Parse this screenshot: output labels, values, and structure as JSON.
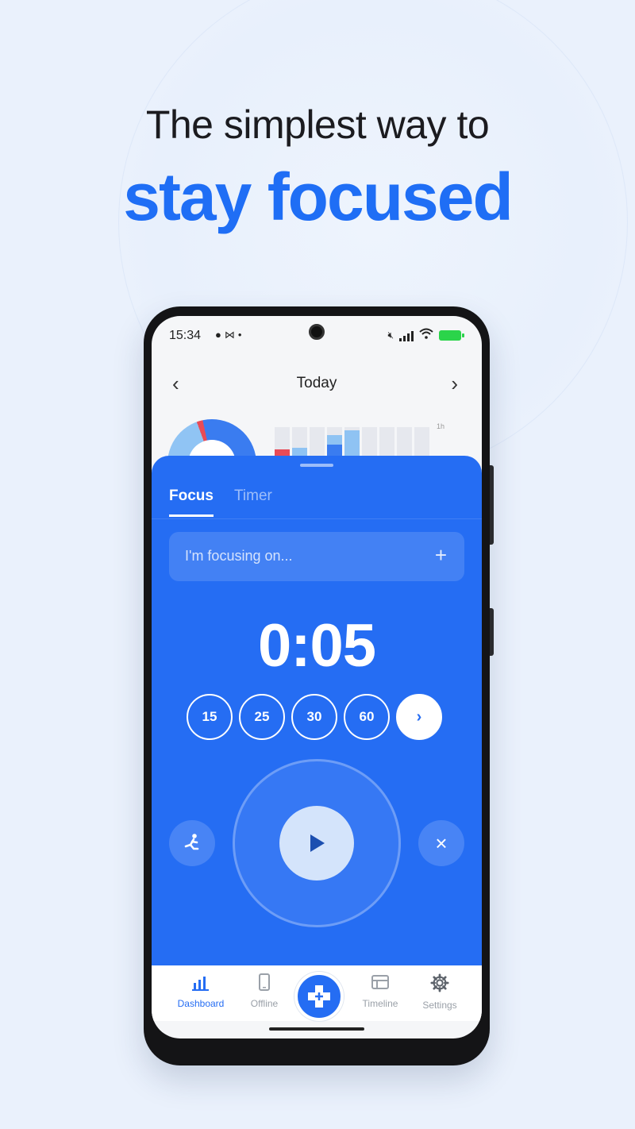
{
  "headline": {
    "line1": "The simplest way to",
    "line2": "stay focused"
  },
  "status_bar": {
    "time": "15:34",
    "notification_icons": [
      "chat-icon",
      "mail-icon",
      "dot-icon"
    ],
    "right_icons": [
      "mute-icon",
      "signal-icon",
      "wifi-icon",
      "battery-icon"
    ]
  },
  "header": {
    "prev_label": "‹",
    "title": "Today",
    "next_label": "›"
  },
  "chart_preview": {
    "axis_label": "1h"
  },
  "sheet": {
    "tabs": [
      {
        "label": "Focus",
        "active": true
      },
      {
        "label": "Timer",
        "active": false
      }
    ],
    "focus_input": {
      "placeholder": "I'm focusing on...",
      "add_label": "+"
    },
    "clock": "0:05",
    "presets": [
      "15",
      "25",
      "30",
      "60"
    ],
    "more_label": "›",
    "close_label": "×"
  },
  "nav": {
    "items": [
      {
        "label": "Dashboard",
        "icon": "bar-chart-icon",
        "active": true
      },
      {
        "label": "Offline",
        "icon": "phone-icon",
        "active": false
      },
      {
        "label": "Timeline",
        "icon": "timeline-icon",
        "active": false
      },
      {
        "label": "Settings",
        "icon": "gear-icon",
        "active": false
      }
    ]
  },
  "colors": {
    "accent": "#256df3",
    "headline_accent": "#1f6ef5",
    "background": "#eaf1fc"
  }
}
